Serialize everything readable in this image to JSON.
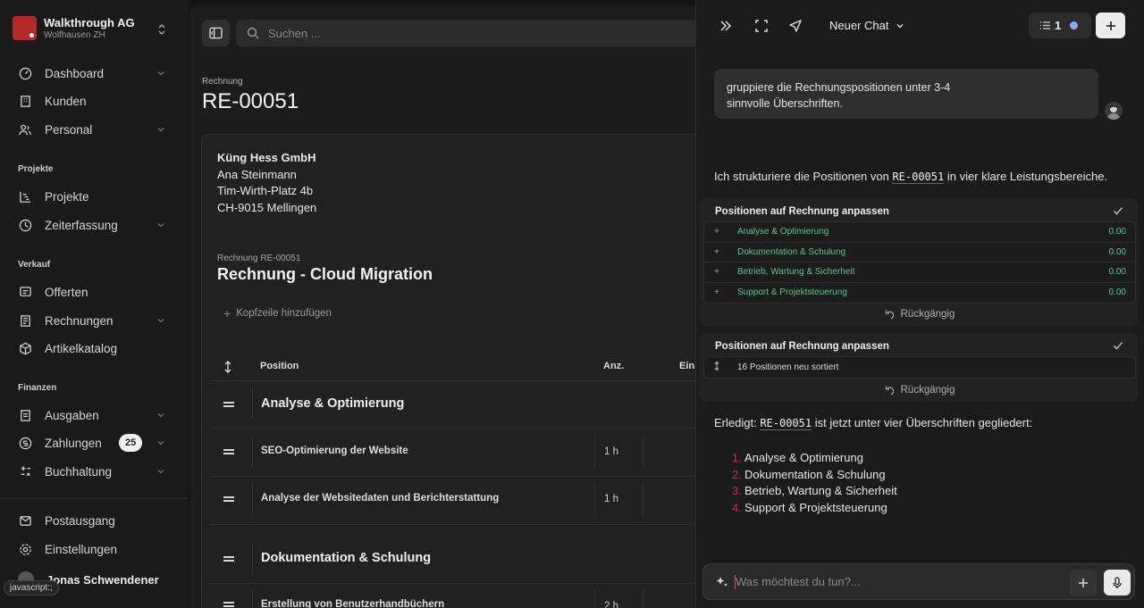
{
  "sidebar": {
    "org": {
      "name": "Walkthrough AG",
      "location": "Wolfhausen ZH"
    },
    "items": {
      "dashboard": "Dashboard",
      "kunden": "Kunden",
      "personal": "Personal",
      "projekte": "Projekte",
      "zeiterfassung": "Zeiterfassung",
      "offerten": "Offerten",
      "rechnungen": "Rechnungen",
      "artikelkatalog": "Artikelkatalog",
      "ausgaben": "Ausgaben",
      "zahlungen": "Zahlungen",
      "buchhaltung": "Buchhaltung",
      "postausgang": "Postausgang",
      "einstellungen": "Einstellungen"
    },
    "sections": {
      "projekte": "Projekte",
      "verkauf": "Verkauf",
      "finanzen": "Finanzen"
    },
    "zahlungen_badge": "25",
    "user_name": "Jonas Schwendener",
    "status_tooltip": "javascript:;"
  },
  "header": {
    "search_placeholder": "Suchen ..."
  },
  "page": {
    "kicker": "Rechnung",
    "title": "RE-00051",
    "address": [
      "Küng Hess GmbH",
      "Ana Steinmann",
      "Tim-Wirth-Platz 4b",
      "CH-9015 Mellingen"
    ],
    "invoice_kicker": "Rechnung RE-00051",
    "invoice_title": "Rechnung - Cloud Migration",
    "add_header": "Kopfzeile hinzufügen",
    "table": {
      "headers": {
        "position": "Position",
        "qty": "Anz.",
        "unit": "Ein."
      },
      "group1": "Analyse & Optimierung",
      "rows1": [
        {
          "text": "SEO-Optimierung der Website",
          "qty": "1 h"
        },
        {
          "text": "Analyse der Websitedaten und Berichterstattung",
          "qty": "1 h"
        }
      ],
      "group2": "Dokumentation & Schulung",
      "rows2": [
        {
          "text": "Erstellung von Benutzerhandbüchern",
          "qty": "2 h"
        }
      ]
    }
  },
  "chat": {
    "title": "Neuer Chat",
    "task_count": "1",
    "user_message": [
      "gruppiere die Rechnungspositionen unter 3-4",
      "sinnvolle Überschriften."
    ],
    "ai_intro": {
      "pre": "Ich strukturiere die Positionen von ",
      "code": "RE-00051",
      "post": " in vier klare Leistungsbereiche."
    },
    "card1": {
      "title": "Positionen auf Rechnung anpassen",
      "rows": [
        {
          "sign": "+",
          "label": "Analyse & Optimierung",
          "value": "0.00"
        },
        {
          "sign": "+",
          "label": "Dokumentation & Schulung",
          "value": "0.00"
        },
        {
          "sign": "+",
          "label": "Betrieb, Wartung & Sicherheit",
          "value": "0.00"
        },
        {
          "sign": "+",
          "label": "Support & Projektsteuerung",
          "value": "0.00"
        }
      ],
      "undo": "Rückgängig"
    },
    "card2": {
      "title": "Positionen auf Rechnung anpassen",
      "row": "16 Positionen neu sortiert",
      "undo": "Rückgängig"
    },
    "done": {
      "pre": "Erledigt: ",
      "code": "RE-00051",
      "post": " ist jetzt unter vier Überschriften gegliedert:"
    },
    "list": [
      {
        "n": "1.",
        "text": "Analyse & Optimierung"
      },
      {
        "n": "2.",
        "text": "Dokumentation & Schulung"
      },
      {
        "n": "3.",
        "text": "Betrieb, Wartung & Sicherheit"
      },
      {
        "n": "4.",
        "text": "Support & Projektsteuerung"
      }
    ],
    "composer_placeholder": "Was möchtest du tun?..."
  },
  "colors": {
    "brand": "#b02a2a",
    "accent_green": "#58c78b",
    "list_number": "#c2372f"
  }
}
